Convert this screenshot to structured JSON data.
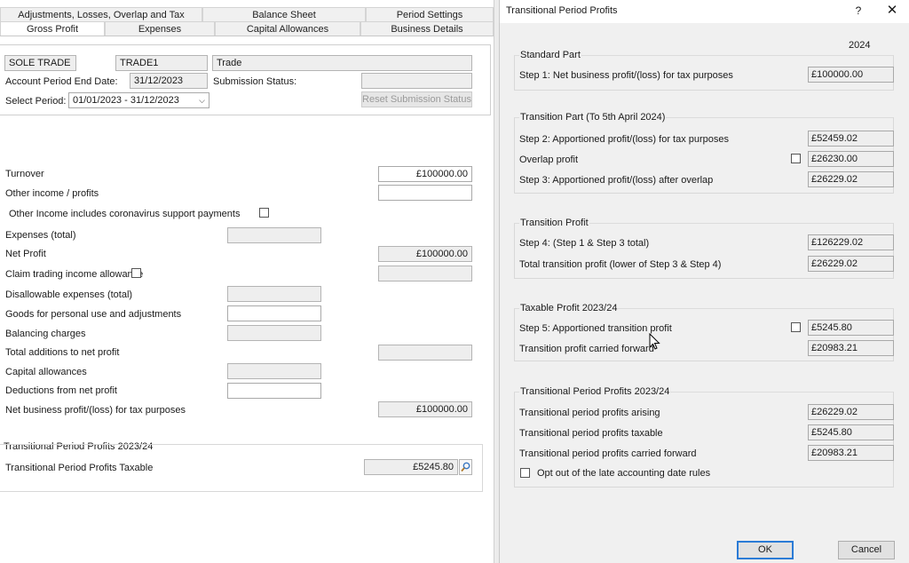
{
  "tabs_row1": [
    {
      "label": "Adjustments, Losses, Overlap and Tax"
    },
    {
      "label": "Balance Sheet"
    },
    {
      "label": "Period Settings"
    }
  ],
  "tabs_row2": [
    {
      "label": "Gross Profit",
      "active": true
    },
    {
      "label": "Expenses"
    },
    {
      "label": "Capital Allowances"
    },
    {
      "label": "Business Details"
    }
  ],
  "header": {
    "trade_type": "SOLE TRADE",
    "trade_id": "TRADE1",
    "trade_name": "Trade",
    "account_end_label": "Account Period End Date:",
    "account_end_value": "31/12/2023",
    "submission_status_label": "Submission Status:",
    "submission_status_value": "",
    "select_period_label": "Select Period:",
    "select_period_value": "01/01/2023 - 31/12/2023",
    "reset_button": "Reset Submission Status"
  },
  "form": {
    "turnover_label": "Turnover",
    "turnover_value": "£100000.00",
    "other_income_label": "Other income / profits",
    "other_income_value": "",
    "coronavirus_label": "Other Income includes coronavirus support payments",
    "expenses_label": "Expenses (total)",
    "expenses_value": "",
    "net_profit_label": "Net Profit",
    "net_profit_value": "£100000.00",
    "claim_trading_label": "Claim trading income allowance",
    "claim_trading_value": "",
    "disallowable_label": "Disallowable expenses (total)",
    "goods_label": "Goods for personal use and adjustments",
    "balancing_label": "Balancing charges",
    "total_additions_label": "Total additions to net profit",
    "capital_allowances_label": "Capital allowances",
    "deductions_label": "Deductions from net profit",
    "net_business_label": "Net business profit/(loss) for tax purposes",
    "net_business_value": "£100000.00"
  },
  "tpp_section": {
    "title": "Transitional Period Profits 2023/24",
    "taxable_label": "Transitional Period Profits Taxable",
    "taxable_value": "£5245.80"
  },
  "dialog": {
    "title": "Transitional Period Profits",
    "help": "?",
    "close": "✕",
    "year_header": "2024",
    "standard_part": {
      "title": "Standard Part",
      "step1_label": "Step 1: Net business profit/(loss) for tax purposes",
      "step1_value": "£100000.00"
    },
    "transition_part": {
      "title": "Transition Part (To 5th April 2024)",
      "step2_label": "Step 2: Apportioned profit/(loss) for tax purposes",
      "step2_value": "£52459.02",
      "overlap_label": "Overlap profit",
      "overlap_value": "£26230.00",
      "step3_label": "Step 3: Apportioned profit/(loss) after overlap",
      "step3_value": "£26229.02"
    },
    "transition_profit": {
      "title": "Transition Profit",
      "step4_label": "Step 4: (Step 1 & Step 3 total)",
      "step4_value": "£126229.02",
      "total_label": "Total transition profit (lower of Step 3 & Step 4)",
      "total_value": "£26229.02"
    },
    "taxable_profit": {
      "title": "Taxable Profit 2023/24",
      "step5_label": "Step 5: Apportioned transition profit",
      "step5_value": "£5245.80",
      "carried_label": "Transition profit carried forward",
      "carried_value": "£20983.21"
    },
    "tpp": {
      "title": "Transitional Period Profits 2023/24",
      "arising_label": "Transitional period profits arising",
      "arising_value": "£26229.02",
      "taxable_label": "Transitional period profits taxable",
      "taxable_value": "£5245.80",
      "carried_label": "Transitional period profits carried forward",
      "carried_value": "£20983.21",
      "optout_label": "Opt out of the late accounting date rules"
    },
    "ok": "OK",
    "cancel": "Cancel"
  }
}
